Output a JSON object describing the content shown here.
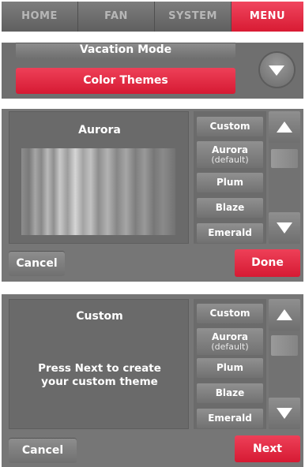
{
  "tabs": [
    {
      "label": "HOME"
    },
    {
      "label": "FAN"
    },
    {
      "label": "SYSTEM"
    },
    {
      "label": "MENU"
    }
  ],
  "menu_panel": {
    "vacation_mode_label": "Vacation Mode",
    "color_themes_label": "Color Themes"
  },
  "theme_screen_1": {
    "preview_title": "Aurora",
    "list": [
      {
        "label": "Custom"
      },
      {
        "label": "Aurora",
        "sub": "(default)"
      },
      {
        "label": "Plum"
      },
      {
        "label": "Blaze"
      },
      {
        "label": "Emerald"
      }
    ],
    "cancel_label": "Cancel",
    "done_label": "Done"
  },
  "theme_screen_2": {
    "preview_title": "Custom",
    "message_line1": "Press Next to create",
    "message_line2": "your custom theme",
    "list": [
      {
        "label": "Custom"
      },
      {
        "label": "Aurora",
        "sub": "(default)"
      },
      {
        "label": "Plum"
      },
      {
        "label": "Blaze"
      },
      {
        "label": "Emerald"
      }
    ],
    "cancel_label": "Cancel",
    "next_label": "Next"
  },
  "colors": {
    "accent_red": "#e02a42",
    "panel_gray": "#767676"
  }
}
